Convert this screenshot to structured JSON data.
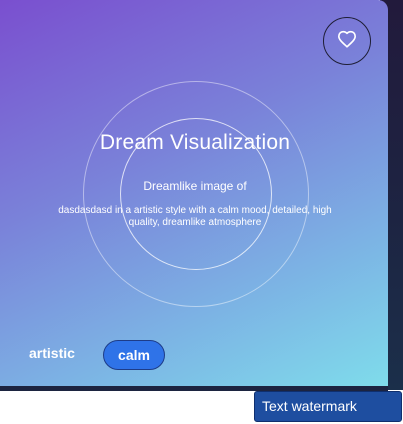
{
  "card": {
    "title": "Dream Visualization",
    "subtitle": "Dreamlike image of",
    "description": "dasdasdasd in a artistic style with a calm mood, detailed, high quality, dreamlike atmosphere",
    "favorite_icon": "heart-icon",
    "tags": [
      "artistic",
      "calm"
    ]
  },
  "watermark": {
    "label": "Text watermark"
  },
  "colors": {
    "gradient_start": "#7a4fcf",
    "gradient_end": "#7fdceb",
    "selected_tag": "#2f73e8",
    "watermark_bg": "#1e4ea0"
  }
}
